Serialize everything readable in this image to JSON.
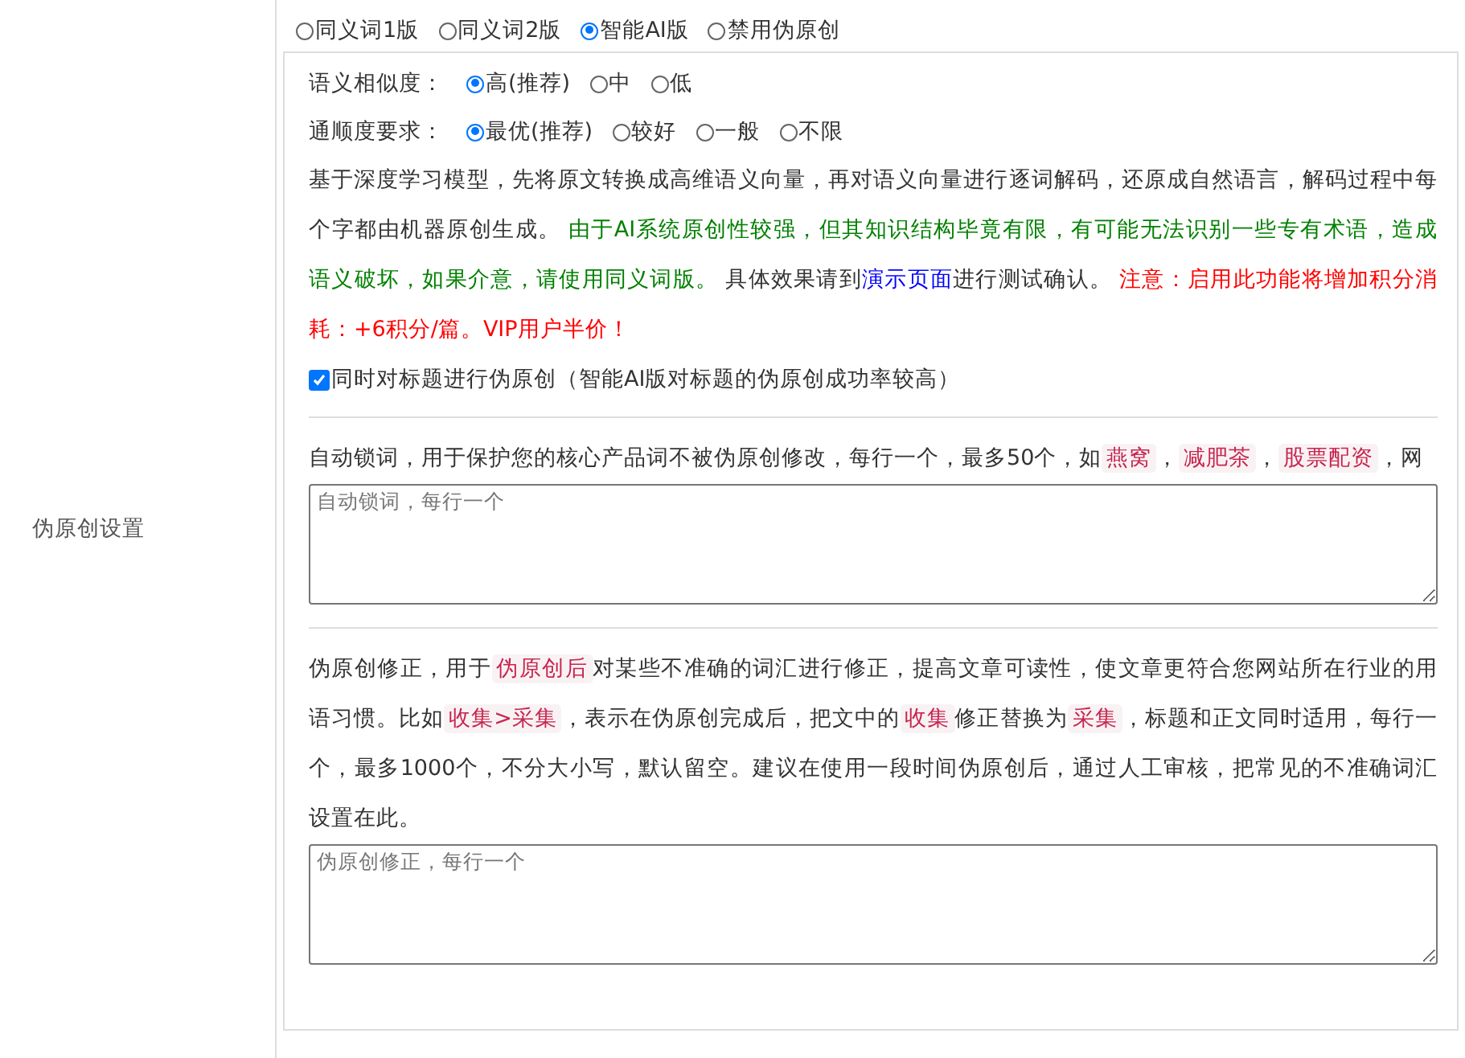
{
  "section_label": "伪原创设置",
  "mode_options": [
    {
      "label": "同义词1版",
      "selected": false
    },
    {
      "label": "同义词2版",
      "selected": false
    },
    {
      "label": "智能AI版",
      "selected": true
    },
    {
      "label": "禁用伪原创",
      "selected": false
    }
  ],
  "similarity": {
    "label": "语义相似度：",
    "options": [
      {
        "label": "高(推荐)",
        "selected": true
      },
      {
        "label": "中",
        "selected": false
      },
      {
        "label": "低",
        "selected": false
      }
    ]
  },
  "fluency": {
    "label": "通顺度要求：",
    "options": [
      {
        "label": "最优(推荐)",
        "selected": true
      },
      {
        "label": "较好",
        "selected": false
      },
      {
        "label": "一般",
        "selected": false
      },
      {
        "label": "不限",
        "selected": false
      }
    ]
  },
  "description": [
    {
      "kind": "plain",
      "text": "基于深度学习模型，先将原文转换成高维语义向量，再对语义向量进行逐词解码，还原成自然语言，解码过程中每个字都由机器原创生成。 "
    },
    {
      "kind": "green",
      "text": "由于AI系统原创性较强，但其知识结构毕竟有限，有可能无法识别一些专有术语，造成语义破坏，如果介意，请使用同义词版。"
    },
    {
      "kind": "plain",
      "text": " 具体效果请到"
    },
    {
      "kind": "link",
      "text": "演示页面"
    },
    {
      "kind": "plain",
      "text": "进行测试确认。 "
    },
    {
      "kind": "red",
      "text": "注意：启用此功能将增加积分消耗：+6积分/篇。VIP用户半价！"
    }
  ],
  "title_checkbox": {
    "label": "同时对标题进行伪原创（智能AI版对标题的伪原创成功率较高）",
    "checked": true
  },
  "lock_words": {
    "segments": [
      {
        "kind": "plain",
        "text": "自动锁词，用于保护您的核心产品词不被伪原创修改，每行一个，最多50个，如"
      },
      {
        "kind": "code",
        "text": "燕窝"
      },
      {
        "kind": "plain",
        "text": "，"
      },
      {
        "kind": "code",
        "text": "减肥茶"
      },
      {
        "kind": "plain",
        "text": "，"
      },
      {
        "kind": "code",
        "text": "股票配资"
      },
      {
        "kind": "plain",
        "text": "，网"
      }
    ],
    "placeholder": "自动锁词，每行一个"
  },
  "correction": {
    "segments": [
      {
        "kind": "plain",
        "text": "伪原创修正，用于"
      },
      {
        "kind": "code",
        "text": "伪原创后"
      },
      {
        "kind": "plain",
        "text": "对某些不准确的词汇进行修正，提高文章可读性，使文章更符合您网站所在行业的用语习惯。比如"
      },
      {
        "kind": "code",
        "text": "收集>采集"
      },
      {
        "kind": "plain",
        "text": "，表示在伪原创完成后，把文中的"
      },
      {
        "kind": "code",
        "text": "收集"
      },
      {
        "kind": "plain",
        "text": "修正替换为"
      },
      {
        "kind": "code",
        "text": "采集"
      },
      {
        "kind": "plain",
        "text": "，标题和正文同时适用，每行一个，最多1000个，不分大小写，默认留空。建议在使用一段时间伪原创后，通过人工审核，把常见的不准确词汇设置在此。"
      }
    ],
    "placeholder": "伪原创修正，每行一个"
  }
}
